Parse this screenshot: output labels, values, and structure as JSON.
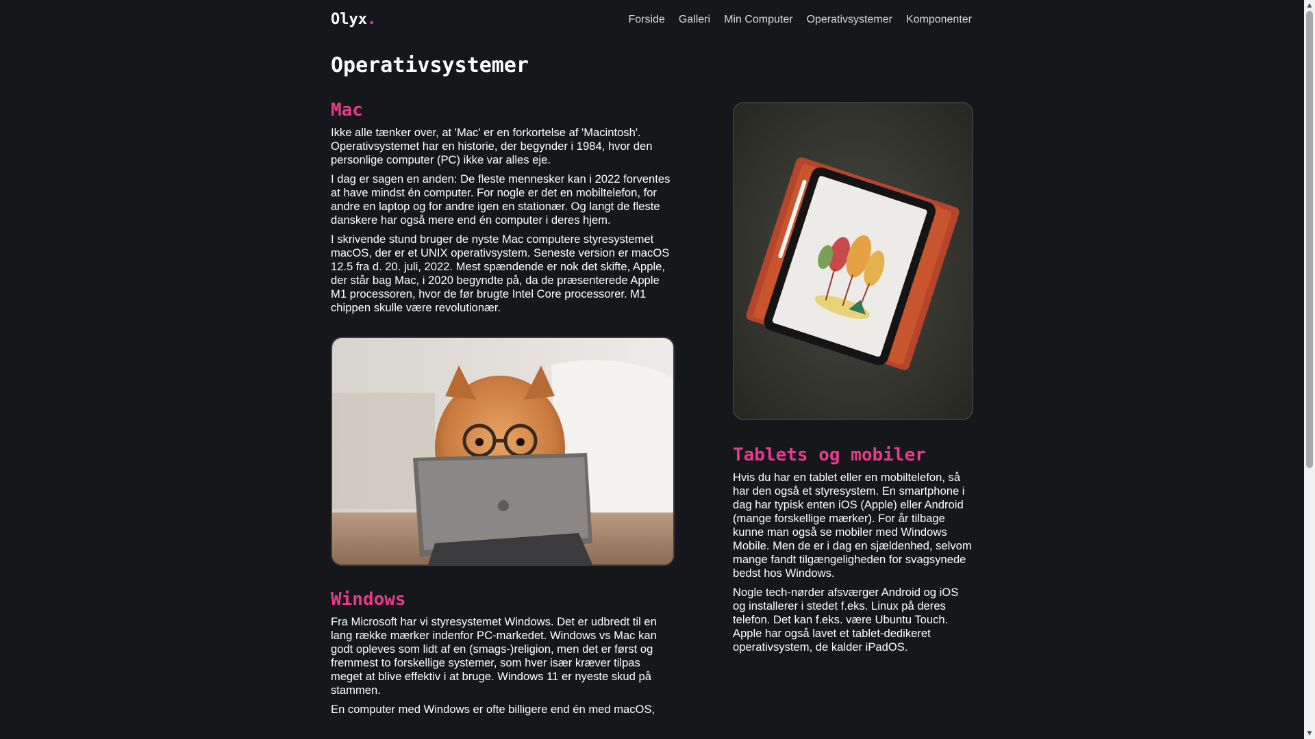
{
  "site": {
    "logo": "Olyx",
    "logo_dot": ".",
    "nav": [
      "Forside",
      "Galleri",
      "Min Computer",
      "Operativsystemer",
      "Komponenter"
    ]
  },
  "page_title": "Operativsystemer",
  "mac": {
    "heading": "Mac",
    "paragraphs": [
      "Ikke alle tænker over, at 'Mac' er en forkortelse af 'Macintosh'. Operativsystemet har en historie, der begynder i 1984, hvor den personlige computer (PC) ikke var alles eje.",
      "I dag er sagen en anden: De fleste mennesker kan i 2022 forventes at have mindst én computer. For nogle er det en mobiltelefon, for andre en laptop og for andre igen en stationær. Og langt de fleste danskere har også mere end én computer i deres hjem.",
      "I skrivende stund bruger de nyste Mac computere styresystemet macOS, der er et UNIX operativsystem. Seneste version er macOS 12.5 fra d. 20. juli, 2022. Mest spændende er nok det skifte, Apple, der står bag Mac, i 2020 begyndte på, da de præsenterede Apple M1 processoren, hvor de før brugte Intel Core processorer. M1 chippen skulle være revolutionær."
    ]
  },
  "windows": {
    "heading": "Windows",
    "paragraphs": [
      "Fra Microsoft har vi styresystemet Windows. Det er udbredt til en lang række mærker indenfor PC-markedet. Windows vs Mac kan godt opleves som lidt af en (smags-)religion, men det er først og fremmest to forskellige systemer, som hver især kræver tilpas meget at blive effektiv i at bruge. Windows 11 er nyeste skud på stammen.",
      "En computer med Windows er ofte billigere end én med macOS,"
    ]
  },
  "tablets": {
    "heading": "Tablets og mobiler",
    "paragraphs": [
      "Hvis du har en tablet eller en mobiltelefon, så har den også et styresystem. En smartphone i dag har typisk enten iOS (Apple) eller Android (mange forskellige mærker). For år tilbage kunne man også se mobiler med Windows Mobile. Men de er i dag en sjældenhed, selvom mange fandt tilgængeligheden for svagsynede bedst hos Windows.",
      "Nogle tech-nørder afsværger Android og iOS og installerer i stedet f.eks. Linux på deres telefon. Det kan f.eks. være Ubuntu Touch. Apple har også lavet et tablet-dedikeret operativsystem, de kalder iPadOS."
    ]
  },
  "colors": {
    "background": "#16171b",
    "accent": "#e83b8c",
    "text": "#ffffff"
  }
}
